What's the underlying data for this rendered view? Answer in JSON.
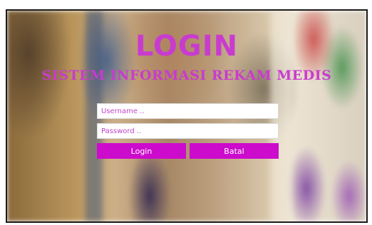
{
  "page": {
    "title": "LOGIN",
    "subtitle": "SISTEM INFORMASI REKAM MEDIS"
  },
  "form": {
    "username": {
      "value": "",
      "placeholder": "Username .."
    },
    "password": {
      "value": "",
      "placeholder": "Password .."
    },
    "login_label": "Login",
    "cancel_label": "Batal"
  },
  "colors": {
    "accent": "#cc0bcc",
    "title": "#c93bcf",
    "frame_border": "#1b1b1b"
  }
}
